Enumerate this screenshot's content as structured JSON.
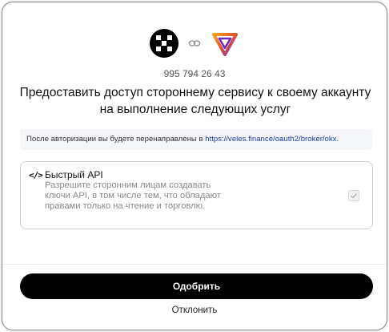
{
  "header": {
    "account_id": "995 794 26 43"
  },
  "title": {
    "line1": "Предоставить доступ стороннему сервису к своему аккаунту",
    "line2": "на выполнение следующих услуг"
  },
  "notice": {
    "text": "После авторизации вы будете перенаправлены в ",
    "link": "https://veles.finance/oauth2/broker/okx",
    "suffix": "."
  },
  "permission": {
    "icon": "code-icon",
    "title": "Быстрый API",
    "description": "Разрешите сторонним лицам создавать ключи API, в том числе тем, что обладают правами только на чтение и торговлю.",
    "checked": true
  },
  "actions": {
    "approve_label": "Одобрить",
    "reject_label": "Отклонить"
  },
  "icons": {
    "okx_logo": "okx-logo-icon",
    "link": "link-icon",
    "veles_logo": "veles-logo-icon"
  }
}
